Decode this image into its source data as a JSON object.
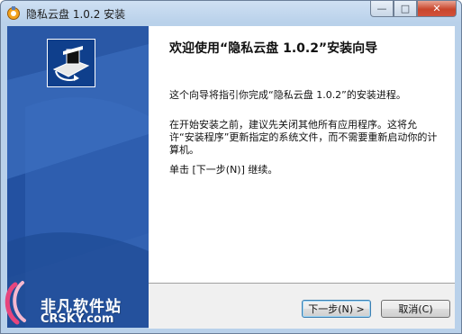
{
  "window": {
    "title": "隐私云盘 1.0.2 安装",
    "controls": {
      "minimize": "—",
      "maximize": "□",
      "close": "✕"
    }
  },
  "wizard": {
    "heading": "欢迎使用“隐私云盘 1.0.2”安装向导",
    "paragraph1": "这个向导将指引你完成“隐私云盘 1.0.2”的安装进程。",
    "paragraph2": "在开始安装之前，建议先关闭其他所有应用程序。这将允许“安装程序”更新指定的系统文件，而不需要重新启动你的计算机。",
    "paragraph3": "单击 [下一步(N)] 继续。"
  },
  "buttons": {
    "next": "下一步(N) >",
    "cancel": "取消(C)"
  },
  "watermark": {
    "name": "非凡软件站",
    "domain": "CRSKY.com"
  },
  "colors": {
    "side_panel": "#2a58a6",
    "title_bar": "#b9d1ea",
    "close_button": "#c9462c"
  },
  "icons": [
    "installer-icon",
    "app-icon",
    "crsky-logo-icon"
  ]
}
